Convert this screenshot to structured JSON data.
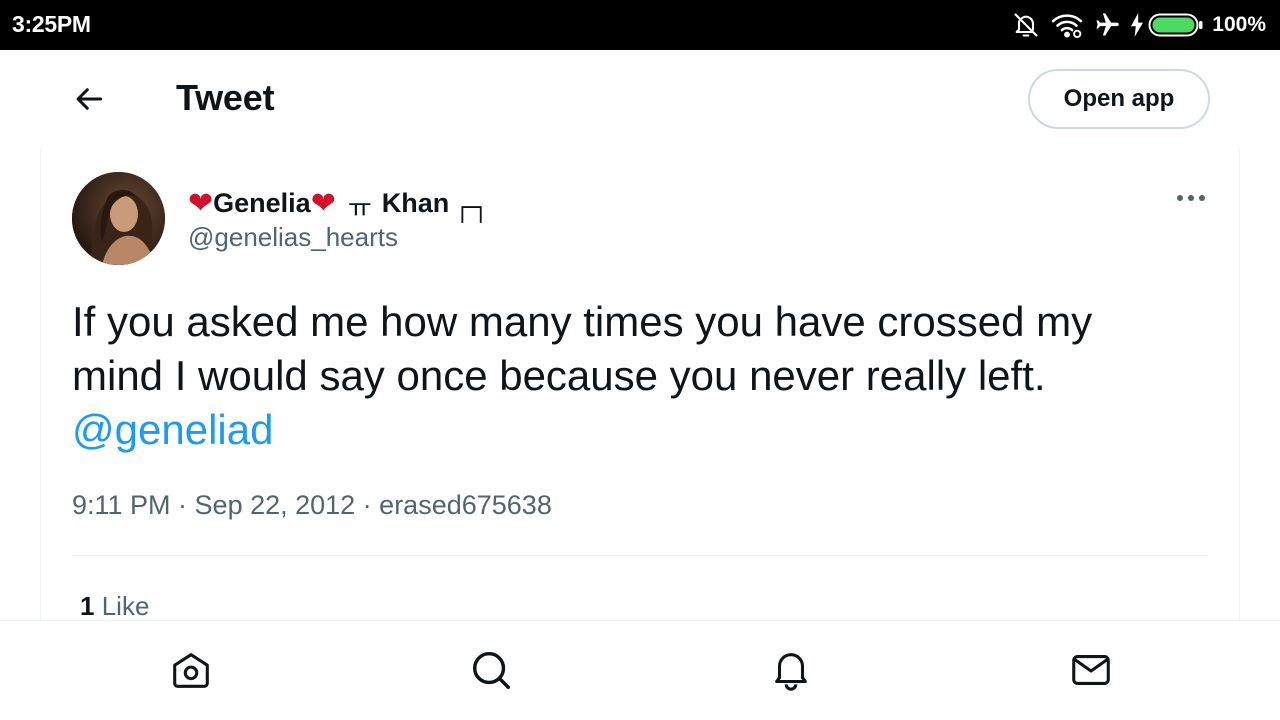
{
  "status_bar": {
    "time": "3:25PM",
    "battery_percent": "100%",
    "icons": [
      "bell-off-icon",
      "wifi-icon",
      "airplane-icon",
      "charging-icon",
      "battery-icon"
    ],
    "battery_color": "#4cd964"
  },
  "header": {
    "back_icon": "arrow-left-icon",
    "title": "Tweet",
    "open_app_label": "Open app"
  },
  "tweet": {
    "author": {
      "name_main": "Genelia",
      "name_suffix": "Khan",
      "handle": "@genelias_hearts"
    },
    "text": "If you asked me how many times you have crossed my mind I would say once because you never really left.",
    "mention": "@geneliad",
    "meta": "9:11 PM · Sep 22, 2012 · erased675638",
    "likes_count": "1",
    "likes_label": "Like"
  },
  "bottom_nav": {
    "items": [
      "home-icon",
      "search-icon",
      "notifications-icon",
      "messages-icon"
    ]
  },
  "colors": {
    "accent": "#1d9bf0",
    "heart": "#d0112b",
    "secondary_text": "#536471",
    "primary_text": "#0f1419"
  }
}
